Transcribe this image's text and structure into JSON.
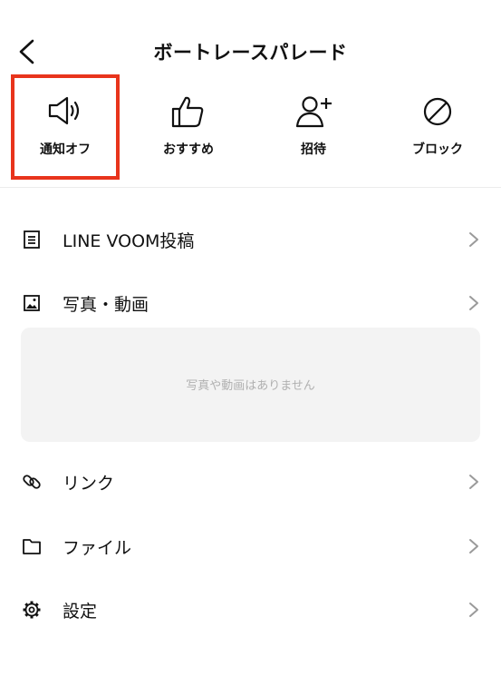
{
  "header": {
    "title": "ボートレースパレード"
  },
  "actions": [
    {
      "label": "通知オフ",
      "icon": "speaker-icon"
    },
    {
      "label": "おすすめ",
      "icon": "thumbs-up-icon"
    },
    {
      "label": "招待",
      "icon": "add-person-icon"
    },
    {
      "label": "ブロック",
      "icon": "block-icon"
    }
  ],
  "highlight": {
    "color": "#e8341c"
  },
  "menu": {
    "voom": "LINE VOOM投稿",
    "media": "写真・動画",
    "media_empty": "写真や動画はありません",
    "links": "リンク",
    "files": "ファイル",
    "settings": "設定"
  }
}
